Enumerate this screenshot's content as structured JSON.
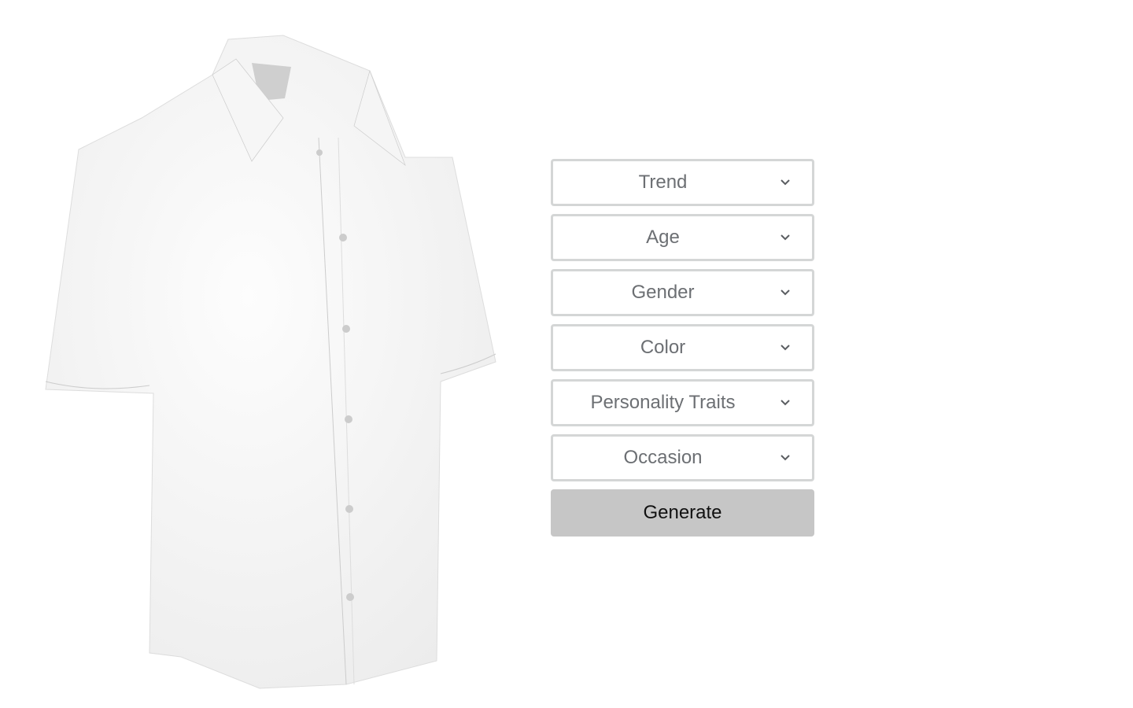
{
  "form": {
    "dropdowns": [
      {
        "label": "Trend"
      },
      {
        "label": "Age"
      },
      {
        "label": "Gender"
      },
      {
        "label": "Color"
      },
      {
        "label": "Personality Traits"
      },
      {
        "label": "Occasion"
      }
    ],
    "generate_label": "Generate"
  },
  "icons": {
    "dropdown": "chevron-down-icon"
  },
  "colors": {
    "border": "#d4d6d6",
    "text": "#6c6f73",
    "button": "#c6c6c6"
  }
}
